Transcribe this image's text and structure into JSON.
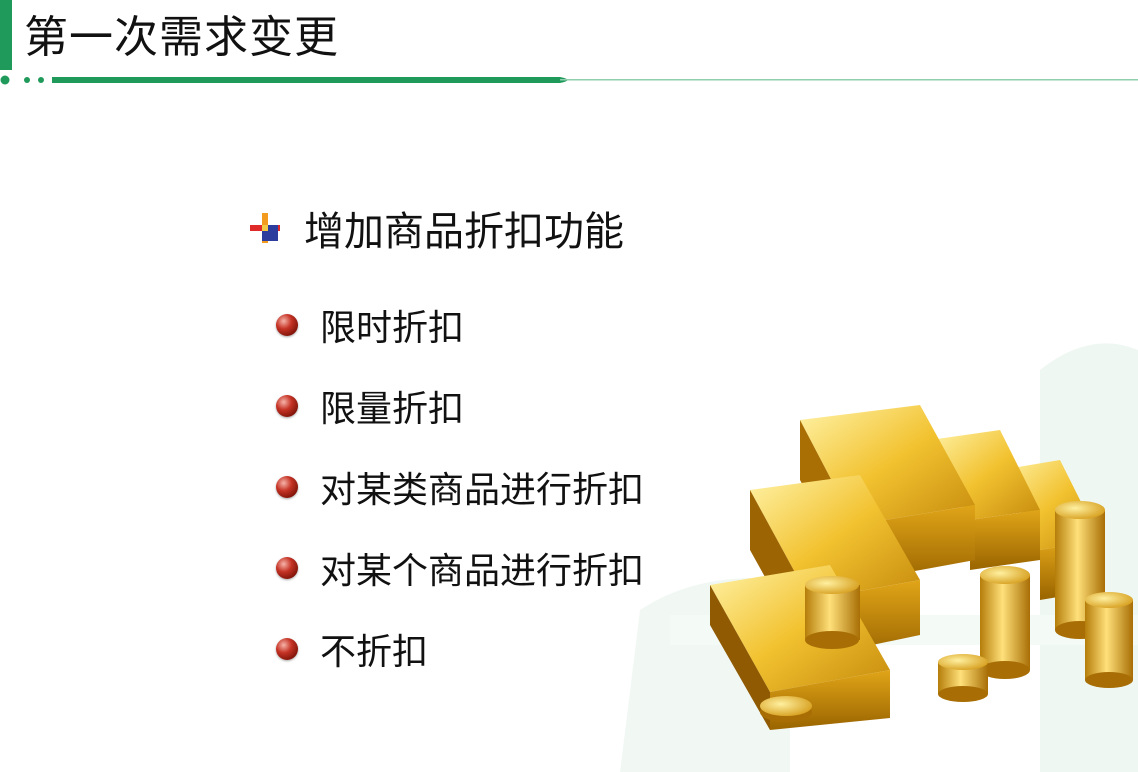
{
  "slide": {
    "title": "第一次需求变更",
    "main_point": "增加商品折扣功能",
    "sub_points": [
      "限时折扣",
      "限量折扣",
      "对某类商品进行折扣",
      "对某个商品进行折扣",
      "不折扣"
    ]
  },
  "colors": {
    "accent_green": "#1f9a5a",
    "bullet_red": "#c53325",
    "gold": "#e8b422"
  },
  "icons": {
    "main_bullet": "plus-bullet-icon",
    "sub_bullet": "red-ball-bullet-icon",
    "illustration": "gold-bars-and-coins"
  }
}
